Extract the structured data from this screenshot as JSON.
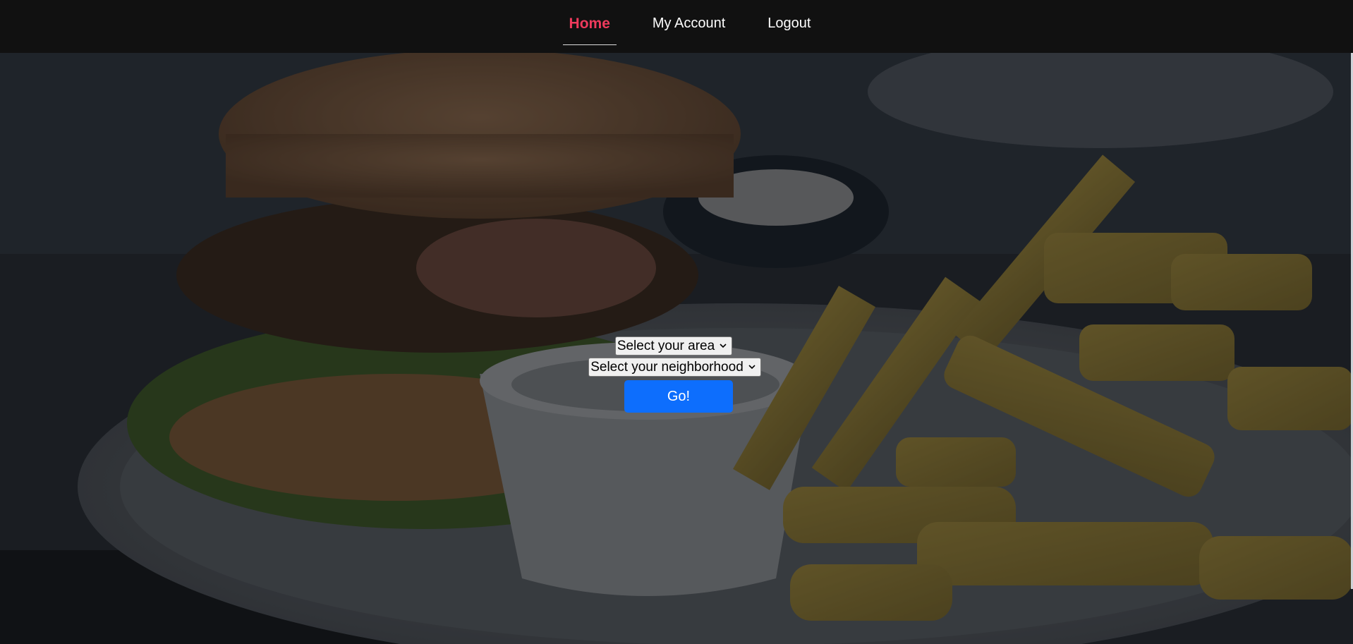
{
  "nav": {
    "items": [
      {
        "label": "Home",
        "active": true
      },
      {
        "label": "My Account",
        "active": false
      },
      {
        "label": "Logout",
        "active": false
      }
    ]
  },
  "form": {
    "area_select": {
      "value": "Select your area"
    },
    "neighborhood_select": {
      "value": "Select your neighborhood"
    },
    "go_label": "Go!"
  },
  "colors": {
    "nav_bg": "#111111",
    "active_link": "#ee3a5c",
    "button_bg": "#0d6efd"
  }
}
